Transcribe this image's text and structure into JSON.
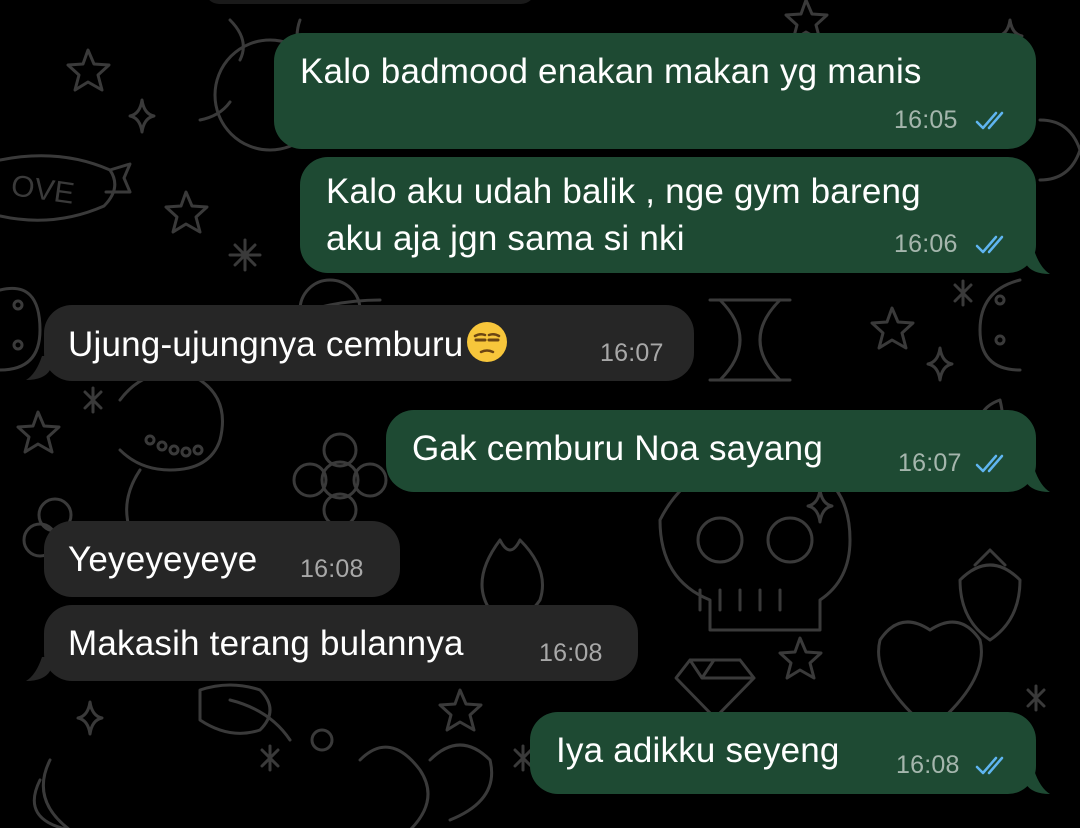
{
  "theme": {
    "background": "#000000",
    "outgoing_bubble": "#1e4a33",
    "incoming_bubble": "#262626",
    "read_ticks": "#5fb5f0",
    "doodle_stroke": "#3a3a3a"
  },
  "messages": [
    {
      "direction": "outgoing",
      "text": "Kalo badmood enakan makan yg manis",
      "time": "16:05",
      "status": "read"
    },
    {
      "direction": "outgoing",
      "text_line1": "Kalo aku udah balik , nge gym bareng",
      "text_line2": "aku aja jgn sama si nki",
      "time": "16:06",
      "status": "read"
    },
    {
      "direction": "incoming",
      "text": "Ujung-ujungnya cemburu",
      "emoji": "unamused-face",
      "time": "16:07"
    },
    {
      "direction": "outgoing",
      "text": "Gak cemburu Noa sayang",
      "time": "16:07",
      "status": "read"
    },
    {
      "direction": "incoming",
      "text": "Yeyeyeyeye",
      "time": "16:08"
    },
    {
      "direction": "incoming",
      "text": "Makasih terang bulannya",
      "time": "16:08"
    },
    {
      "direction": "outgoing",
      "text": "Iya adikku seyeng",
      "time": "16:08",
      "status": "read"
    }
  ],
  "wallpaper": {
    "doodle_text": "OVE"
  }
}
